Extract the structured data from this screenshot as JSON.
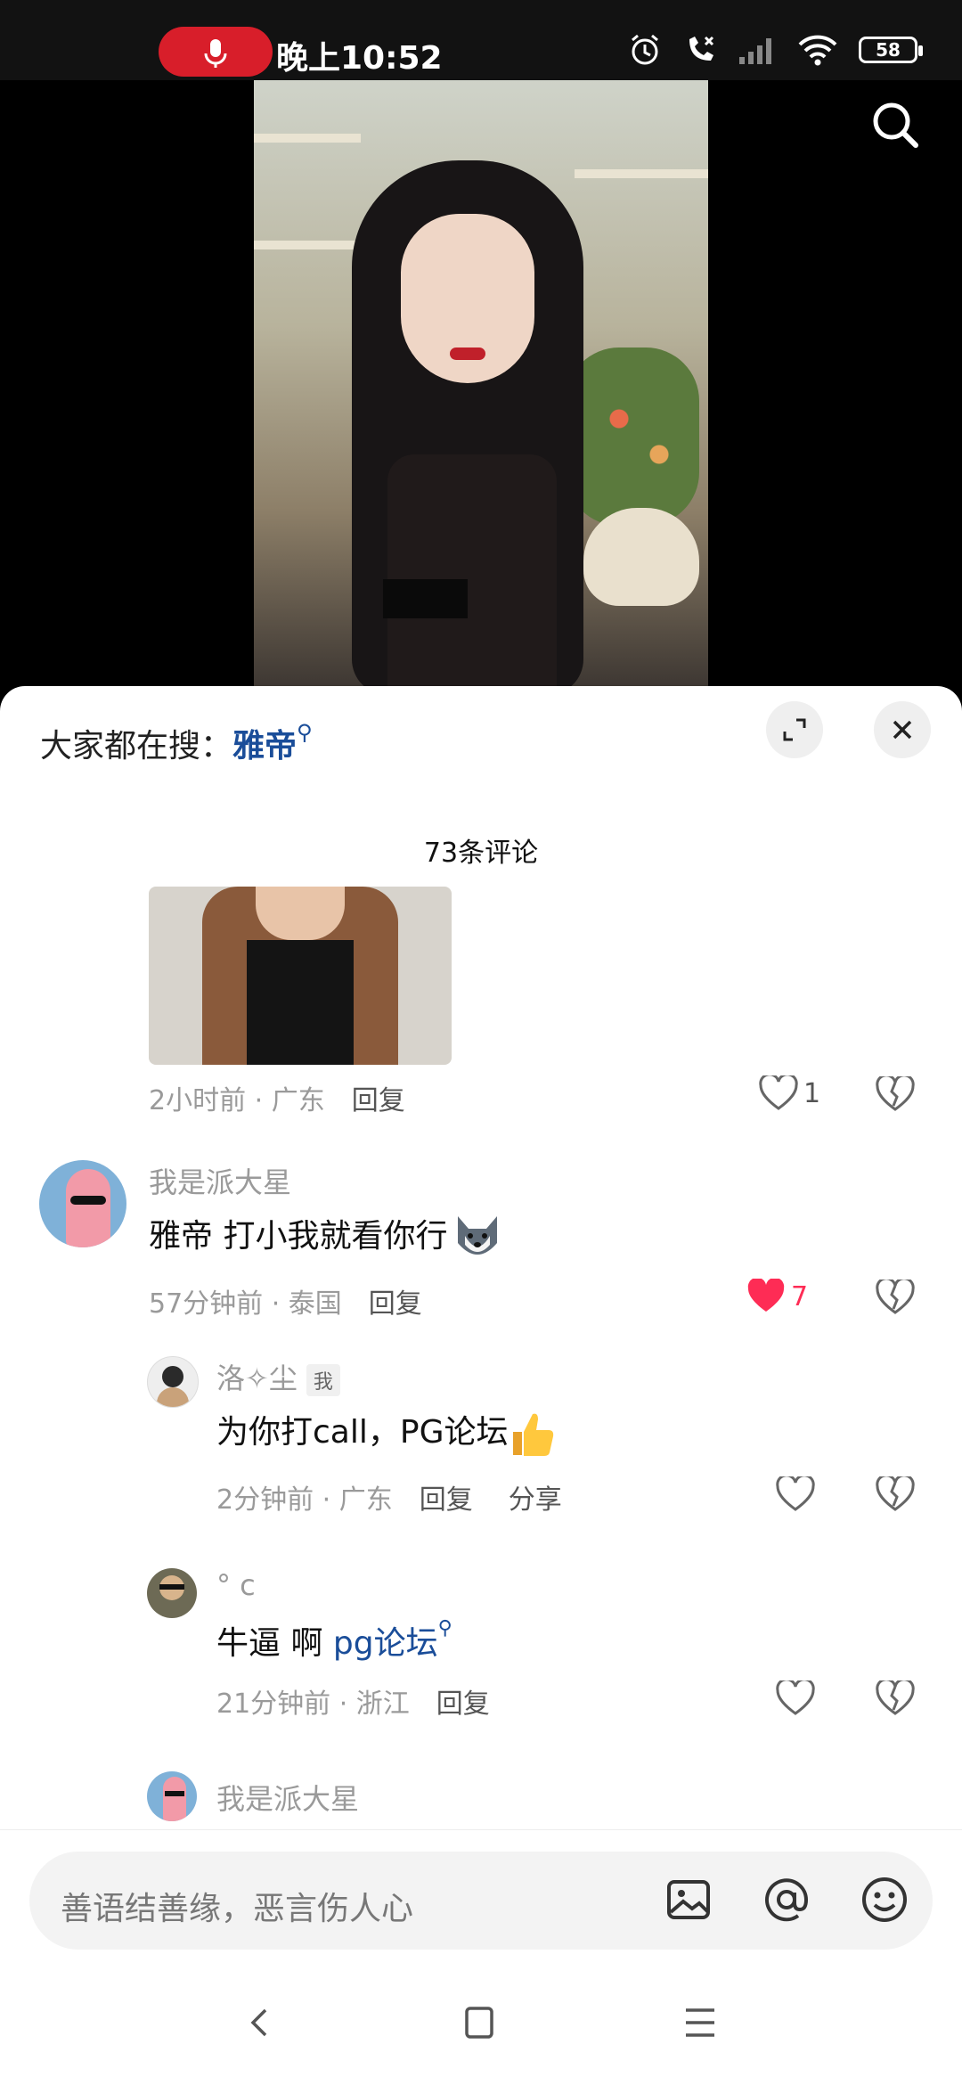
{
  "status_bar": {
    "time": "晚上10:52",
    "battery": "58",
    "icons": [
      "mic-icon",
      "alarm-icon",
      "no-call-icon",
      "signal-icon",
      "wifi-icon",
      "battery-icon"
    ]
  },
  "video": {
    "search_icon": "search-icon"
  },
  "sheet": {
    "hot_search_prefix": "大家都在搜：",
    "hot_search_keyword": "雅帝",
    "comment_count": "73条评论"
  },
  "comments": [
    {
      "time": "2小时前",
      "location": "广东",
      "reply_label": "回复",
      "likes": "1"
    },
    {
      "name": "我是派大星",
      "text": "雅帝 打小我就看你行",
      "time": "57分钟前",
      "location": "泰国",
      "reply_label": "回复",
      "likes": "7",
      "liked": true,
      "like_color": "#fe2c55"
    },
    {
      "name": "洛✧尘",
      "me_tag": "我",
      "text": "为你打call，PG论坛",
      "time": "2分钟前",
      "location": "广东",
      "reply_label": "回复",
      "share_label": "分享"
    },
    {
      "name": "°  c",
      "text_prefix": "牛逼 啊 ",
      "text_link": "pg论坛",
      "time": "21分钟前",
      "location": "浙江",
      "reply_label": "回复"
    },
    {
      "name": "我是派大星"
    }
  ],
  "input": {
    "placeholder": "善语结善缘，恶言伤人心",
    "icons": [
      "image-icon",
      "at-icon",
      "emoji-icon"
    ]
  },
  "colors": {
    "link": "#1a4d99",
    "liked": "#fe2c55",
    "record": "#d81e2a"
  }
}
